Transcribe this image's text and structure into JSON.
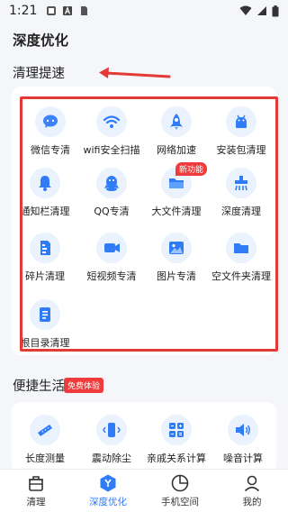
{
  "status_bar": {
    "time": "1:21"
  },
  "page_title": "深度优化",
  "section_title": "清理提速",
  "grid_items": [
    {
      "label": "微信专清",
      "icon": "wechat-icon"
    },
    {
      "label": "wifi安全扫描",
      "icon": "wifi-icon"
    },
    {
      "label": "网络加速",
      "icon": "rocket-icon"
    },
    {
      "label": "安装包清理",
      "icon": "android-icon"
    },
    {
      "label": "通知栏清理",
      "icon": "bell-icon"
    },
    {
      "label": "QQ专清",
      "icon": "qq-icon"
    },
    {
      "label": "大文件清理",
      "icon": "folder-icon"
    },
    {
      "label": "深度清理",
      "icon": "deep-clean-icon"
    },
    {
      "label": "碎片清理",
      "icon": "fragment-icon"
    },
    {
      "label": "短视频专清",
      "icon": "video-icon"
    },
    {
      "label": "图片专清",
      "icon": "image-icon"
    },
    {
      "label": "空文件夹清理",
      "icon": "empty-folder-icon"
    },
    {
      "label": "根目录清理",
      "icon": "document-icon"
    }
  ],
  "new_feature_badge": "新功能",
  "life_section": {
    "title": "便捷生活",
    "badge": "免费体验"
  },
  "life_items": [
    {
      "label": "长度测量",
      "icon": "ruler-icon"
    },
    {
      "label": "震动除尘",
      "icon": "vibrate-icon"
    },
    {
      "label": "亲戚关系计算",
      "icon": "relation-calc-icon"
    },
    {
      "label": "噪音计算",
      "icon": "speaker-icon"
    }
  ],
  "bottom_nav": [
    {
      "label": "清理",
      "icon": "trash-icon",
      "active": false
    },
    {
      "label": "深度优化",
      "icon": "optimize-icon",
      "active": true
    },
    {
      "label": "手机空间",
      "icon": "storage-pie-icon",
      "active": false
    },
    {
      "label": "我的",
      "icon": "profile-icon",
      "active": false
    }
  ],
  "colors": {
    "accent": "#2f7cf6",
    "highlight": "#e53935",
    "badge_red": "#ef3b3b"
  }
}
